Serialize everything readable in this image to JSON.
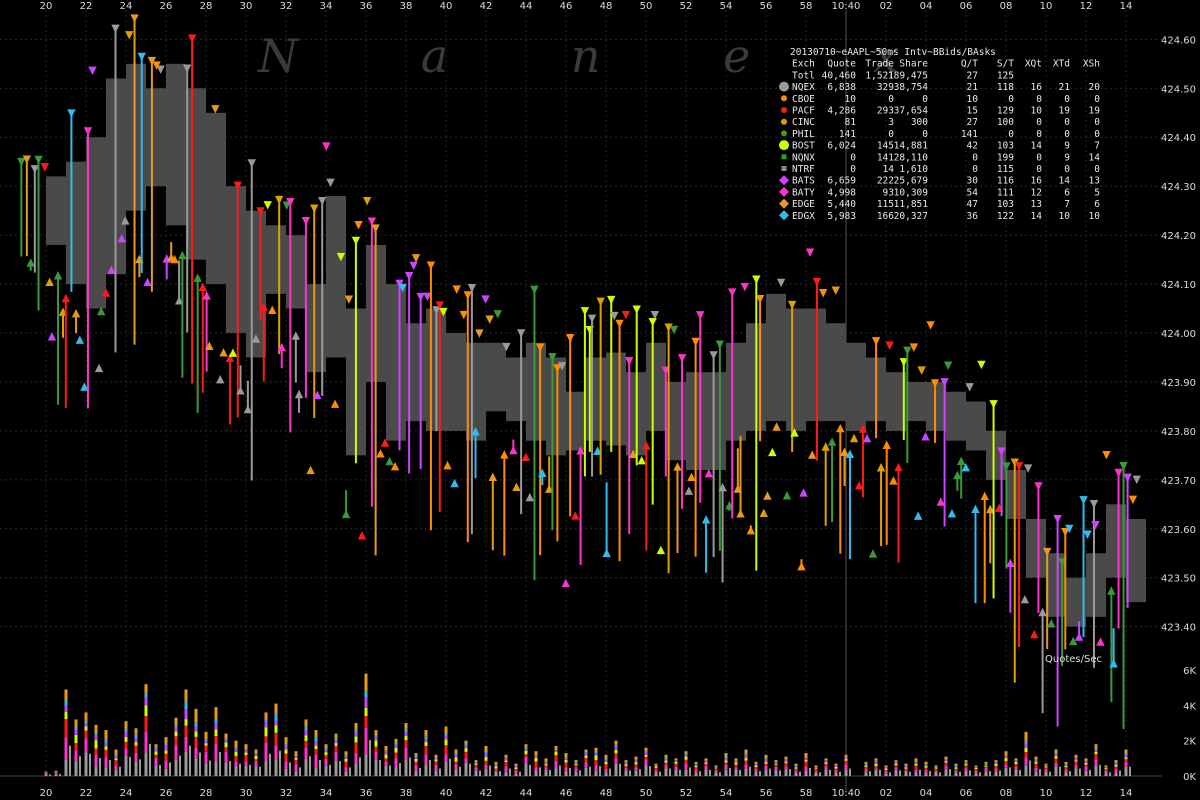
{
  "chart_data": [
    {
      "type": "scatter",
      "title": "20130710~eAAPL~50ms Intv~BBids/BAsks",
      "watermark": "N a n e x",
      "ylim": [
        423.34,
        424.66
      ],
      "y_ticks": [
        "424.60",
        "424.50",
        "424.40",
        "424.30",
        "424.20",
        "424.10",
        "424.00",
        "423.90",
        "423.80",
        "423.70",
        "423.60",
        "423.50",
        "423.40"
      ],
      "x_ticks_top": [
        "20",
        "22",
        "24",
        "26",
        "28",
        "30",
        "32",
        "34",
        "36",
        "38",
        "40",
        "42",
        "44",
        "46",
        "48",
        "50",
        "52",
        "54",
        "56",
        "58",
        "10:40",
        "02",
        "04",
        "06",
        "08",
        "10",
        "12",
        "14"
      ],
      "x_ticks_bottom": [
        "20",
        "22",
        "24",
        "26",
        "28",
        "30",
        "32",
        "34",
        "36",
        "38",
        "40",
        "42",
        "44",
        "46",
        "48",
        "50",
        "52",
        "54",
        "56",
        "58",
        "10:40",
        "02",
        "04",
        "06",
        "08",
        "10",
        "12",
        "14"
      ],
      "grid": true,
      "legend_placement": "top-right",
      "legend_header": [
        "Exch",
        "Quote",
        "Trade",
        "Share",
        "Q/T",
        "S/T",
        "XQt",
        "XTd",
        "XSh"
      ],
      "legend_total": [
        "Totl",
        "40,460",
        "1,521",
        "189,475",
        "27",
        "125",
        "",
        "",
        ""
      ],
      "series": [
        {
          "name": "NQEX",
          "quote": "6,838",
          "trade": "329",
          "share": "38,754",
          "qt": "21",
          "st": "118",
          "xqt": "16",
          "xtd": "21",
          "xsh": "20",
          "color": "#9a9a9a",
          "marker": "circle-large"
        },
        {
          "name": "CBOE",
          "quote": "10",
          "trade": "0",
          "share": "0",
          "qt": "10",
          "st": "0",
          "xqt": "0",
          "xtd": "0",
          "xsh": "0",
          "color": "#ff8c00",
          "marker": "circle"
        },
        {
          "name": "PACF",
          "quote": "4,286",
          "trade": "293",
          "share": "37,654",
          "qt": "15",
          "st": "129",
          "xqt": "10",
          "xtd": "19",
          "xsh": "19",
          "color": "#ff1a1a",
          "marker": "circle"
        },
        {
          "name": "CINC",
          "quote": "81",
          "trade": "3",
          "share": "300",
          "qt": "27",
          "st": "100",
          "xqt": "0",
          "xtd": "0",
          "xsh": "0",
          "color": "#e0a000",
          "marker": "circle"
        },
        {
          "name": "PHIL",
          "quote": "141",
          "trade": "0",
          "share": "0",
          "qt": "141",
          "st": "0",
          "xqt": "0",
          "xtd": "0",
          "xsh": "0",
          "color": "#3a9a3a",
          "marker": "circle"
        },
        {
          "name": "BOST",
          "quote": "6,024",
          "trade": "145",
          "share": "14,881",
          "qt": "42",
          "st": "103",
          "xqt": "14",
          "xtd": "9",
          "xsh": "7",
          "color": "#ccff00",
          "marker": "circle-large"
        },
        {
          "name": "NQNX",
          "quote": "0",
          "trade": "141",
          "share": "28,110",
          "qt": "0",
          "st": "199",
          "xqt": "0",
          "xtd": "9",
          "xsh": "14",
          "color": "#22aa22",
          "marker": "square"
        },
        {
          "name": "NTRF",
          "quote": "0",
          "trade": "14",
          "share": "1,610",
          "qt": "0",
          "st": "115",
          "xqt": "0",
          "xtd": "0",
          "xsh": "0",
          "color": "#8a8a8a",
          "marker": "square"
        },
        {
          "name": "BATS",
          "quote": "6,659",
          "trade": "222",
          "share": "25,679",
          "qt": "30",
          "st": "116",
          "xqt": "16",
          "xtd": "14",
          "xsh": "13",
          "color": "#cc44ff",
          "marker": "diamond"
        },
        {
          "name": "BATY",
          "quote": "4,998",
          "trade": "93",
          "share": "10,309",
          "qt": "54",
          "st": "111",
          "xqt": "12",
          "xtd": "6",
          "xsh": "5",
          "color": "#ff33cc",
          "marker": "diamond"
        },
        {
          "name": "EDGE",
          "quote": "5,440",
          "trade": "115",
          "share": "11,851",
          "qt": "47",
          "st": "103",
          "xqt": "13",
          "xtd": "7",
          "xsh": "6",
          "color": "#e69a20",
          "marker": "diamond"
        },
        {
          "name": "EDGX",
          "quote": "5,983",
          "trade": "166",
          "share": "20,327",
          "qt": "36",
          "st": "122",
          "xqt": "14",
          "xtd": "10",
          "xsh": "10",
          "color": "#33bbee",
          "marker": "diamond"
        }
      ],
      "nbbo_path": [
        {
          "x": "20",
          "bid": 424.18,
          "ask": 424.32
        },
        {
          "x": "21",
          "bid": 424.1,
          "ask": 424.35
        },
        {
          "x": "22",
          "bid": 424.05,
          "ask": 424.4
        },
        {
          "x": "23",
          "bid": 424.12,
          "ask": 424.52
        },
        {
          "x": "24",
          "bid": 424.25,
          "ask": 424.55
        },
        {
          "x": "25",
          "bid": 424.3,
          "ask": 424.5
        },
        {
          "x": "26",
          "bid": 424.22,
          "ask": 424.55
        },
        {
          "x": "27",
          "bid": 424.15,
          "ask": 424.5
        },
        {
          "x": "28",
          "bid": 424.1,
          "ask": 424.45
        },
        {
          "x": "29",
          "bid": 424.0,
          "ask": 424.3
        },
        {
          "x": "30",
          "bid": 423.95,
          "ask": 424.25
        },
        {
          "x": "31",
          "bid": 424.08,
          "ask": 424.22
        },
        {
          "x": "32",
          "bid": 424.05,
          "ask": 424.2
        },
        {
          "x": "33",
          "bid": 423.92,
          "ask": 424.1
        },
        {
          "x": "34",
          "bid": 423.95,
          "ask": 424.28
        },
        {
          "x": "35",
          "bid": 423.75,
          "ask": 424.05
        },
        {
          "x": "36",
          "bid": 423.9,
          "ask": 424.18
        },
        {
          "x": "37",
          "bid": 423.78,
          "ask": 424.1
        },
        {
          "x": "38",
          "bid": 423.82,
          "ask": 424.02
        },
        {
          "x": "39",
          "bid": 423.8,
          "ask": 424.05
        },
        {
          "x": "40",
          "bid": 423.8,
          "ask": 424.0
        },
        {
          "x": "41",
          "bid": 423.78,
          "ask": 423.98
        },
        {
          "x": "42",
          "bid": 423.84,
          "ask": 423.98
        },
        {
          "x": "43",
          "bid": 423.82,
          "ask": 423.95
        },
        {
          "x": "44",
          "bid": 423.78,
          "ask": 423.98
        },
        {
          "x": "45",
          "bid": 423.75,
          "ask": 423.95
        },
        {
          "x": "46",
          "bid": 423.76,
          "ask": 423.88
        },
        {
          "x": "47",
          "bid": 423.78,
          "ask": 423.95
        },
        {
          "x": "48",
          "bid": 423.77,
          "ask": 423.96
        },
        {
          "x": "49",
          "bid": 423.75,
          "ask": 423.92
        },
        {
          "x": "50",
          "bid": 423.8,
          "ask": 423.98
        },
        {
          "x": "51",
          "bid": 423.74,
          "ask": 423.9
        },
        {
          "x": "52",
          "bid": 423.72,
          "ask": 423.92
        },
        {
          "x": "53",
          "bid": 423.72,
          "ask": 423.92
        },
        {
          "x": "54",
          "bid": 423.78,
          "ask": 423.98
        },
        {
          "x": "55",
          "bid": 423.8,
          "ask": 424.02
        },
        {
          "x": "56",
          "bid": 423.82,
          "ask": 424.08
        },
        {
          "x": "57",
          "bid": 423.8,
          "ask": 424.05
        },
        {
          "x": "58",
          "bid": 423.82,
          "ask": 424.05
        },
        {
          "x": "59",
          "bid": 423.82,
          "ask": 424.02
        },
        {
          "x": "10:40",
          "bid": 423.8,
          "ask": 423.98
        },
        {
          "x": "01",
          "bid": 423.82,
          "ask": 423.95
        },
        {
          "x": "02",
          "bid": 423.8,
          "ask": 423.92
        },
        {
          "x": "03",
          "bid": 423.82,
          "ask": 423.9
        },
        {
          "x": "04",
          "bid": 423.8,
          "ask": 423.9
        },
        {
          "x": "05",
          "bid": 423.78,
          "ask": 423.88
        },
        {
          "x": "06",
          "bid": 423.76,
          "ask": 423.86
        },
        {
          "x": "07",
          "bid": 423.7,
          "ask": 423.8
        },
        {
          "x": "08",
          "bid": 423.62,
          "ask": 423.72
        },
        {
          "x": "09",
          "bid": 423.5,
          "ask": 423.62
        },
        {
          "x": "10",
          "bid": 423.42,
          "ask": 423.55
        },
        {
          "x": "11",
          "bid": 423.4,
          "ask": 423.5
        },
        {
          "x": "12",
          "bid": 423.42,
          "ask": 423.55
        },
        {
          "x": "13",
          "bid": 423.5,
          "ask": 423.65
        },
        {
          "x": "14",
          "bid": 423.45,
          "ask": 423.62
        }
      ]
    },
    {
      "type": "area",
      "title": "Quotes/Sec",
      "ylim": [
        0,
        6000
      ],
      "y_ticks": [
        "6K",
        "4K",
        "2K",
        "0K"
      ],
      "bursts": [
        {
          "x": "20",
          "value": 250
        },
        {
          "x": "20.5",
          "value": 300
        },
        {
          "x": "21",
          "value": 4900
        },
        {
          "x": "21.5",
          "value": 3200
        },
        {
          "x": "22",
          "value": 3600
        },
        {
          "x": "22.5",
          "value": 2900
        },
        {
          "x": "23",
          "value": 2600
        },
        {
          "x": "23.5",
          "value": 1500
        },
        {
          "x": "24",
          "value": 3100
        },
        {
          "x": "24.5",
          "value": 2700
        },
        {
          "x": "25",
          "value": 5200
        },
        {
          "x": "25.5",
          "value": 1800
        },
        {
          "x": "26",
          "value": 2200
        },
        {
          "x": "26.5",
          "value": 3300
        },
        {
          "x": "27",
          "value": 4900
        },
        {
          "x": "27.5",
          "value": 3800
        },
        {
          "x": "28",
          "value": 2500
        },
        {
          "x": "28.5",
          "value": 3900
        },
        {
          "x": "29",
          "value": 2400
        },
        {
          "x": "29.5",
          "value": 2000
        },
        {
          "x": "30",
          "value": 1800
        },
        {
          "x": "30.5",
          "value": 1500
        },
        {
          "x": "31",
          "value": 3600
        },
        {
          "x": "31.5",
          "value": 4100
        },
        {
          "x": "32",
          "value": 2200
        },
        {
          "x": "32.5",
          "value": 1400
        },
        {
          "x": "33",
          "value": 3200
        },
        {
          "x": "33.5",
          "value": 2600
        },
        {
          "x": "34",
          "value": 1800
        },
        {
          "x": "34.5",
          "value": 2400
        },
        {
          "x": "35",
          "value": 1400
        },
        {
          "x": "35.5",
          "value": 3000
        },
        {
          "x": "36",
          "value": 5800
        },
        {
          "x": "36.5",
          "value": 2600
        },
        {
          "x": "37",
          "value": 1700
        },
        {
          "x": "37.5",
          "value": 2100
        },
        {
          "x": "38",
          "value": 3000
        },
        {
          "x": "38.5",
          "value": 1300
        },
        {
          "x": "39",
          "value": 2600
        },
        {
          "x": "39.5",
          "value": 1200
        },
        {
          "x": "40",
          "value": 2800
        },
        {
          "x": "40.5",
          "value": 1500
        },
        {
          "x": "41",
          "value": 2000
        },
        {
          "x": "41.5",
          "value": 900
        },
        {
          "x": "42",
          "value": 1700
        },
        {
          "x": "42.5",
          "value": 800
        },
        {
          "x": "43",
          "value": 1200
        },
        {
          "x": "43.5",
          "value": 700
        },
        {
          "x": "44",
          "value": 1800
        },
        {
          "x": "44.5",
          "value": 1400
        },
        {
          "x": "45",
          "value": 1000
        },
        {
          "x": "45.5",
          "value": 1700
        },
        {
          "x": "46",
          "value": 1300
        },
        {
          "x": "46.5",
          "value": 900
        },
        {
          "x": "47",
          "value": 1500
        },
        {
          "x": "47.5",
          "value": 1600
        },
        {
          "x": "48",
          "value": 1200
        },
        {
          "x": "48.5",
          "value": 2000
        },
        {
          "x": "49",
          "value": 900
        },
        {
          "x": "49.5",
          "value": 1100
        },
        {
          "x": "50",
          "value": 1600
        },
        {
          "x": "50.5",
          "value": 700
        },
        {
          "x": "51",
          "value": 1200
        },
        {
          "x": "51.5",
          "value": 1000
        },
        {
          "x": "52",
          "value": 1400
        },
        {
          "x": "52.5",
          "value": 800
        },
        {
          "x": "53",
          "value": 1000
        },
        {
          "x": "53.5",
          "value": 600
        },
        {
          "x": "54",
          "value": 1300
        },
        {
          "x": "54.5",
          "value": 1000
        },
        {
          "x": "55",
          "value": 1500
        },
        {
          "x": "55.5",
          "value": 800
        },
        {
          "x": "56",
          "value": 1200
        },
        {
          "x": "56.5",
          "value": 900
        },
        {
          "x": "57",
          "value": 1100
        },
        {
          "x": "57.5",
          "value": 700
        },
        {
          "x": "58",
          "value": 1300
        },
        {
          "x": "58.5",
          "value": 600
        },
        {
          "x": "59",
          "value": 1000
        },
        {
          "x": "59.5",
          "value": 700
        },
        {
          "x": "10:40",
          "value": 1200
        },
        {
          "x": "01",
          "value": 800
        },
        {
          "x": "01.5",
          "value": 1000
        },
        {
          "x": "02",
          "value": 600
        },
        {
          "x": "02.5",
          "value": 900
        },
        {
          "x": "03",
          "value": 700
        },
        {
          "x": "03.5",
          "value": 1000
        },
        {
          "x": "04",
          "value": 800
        },
        {
          "x": "04.5",
          "value": 600
        },
        {
          "x": "05",
          "value": 1100
        },
        {
          "x": "05.5",
          "value": 700
        },
        {
          "x": "06",
          "value": 900
        },
        {
          "x": "06.5",
          "value": 600
        },
        {
          "x": "07",
          "value": 800
        },
        {
          "x": "07.5",
          "value": 900
        },
        {
          "x": "08",
          "value": 1400
        },
        {
          "x": "08.5",
          "value": 1000
        },
        {
          "x": "09",
          "value": 2500
        },
        {
          "x": "09.5",
          "value": 1100
        },
        {
          "x": "10",
          "value": 700
        },
        {
          "x": "10.5",
          "value": 1500
        },
        {
          "x": "11",
          "value": 800
        },
        {
          "x": "11.5",
          "value": 1200
        },
        {
          "x": "12",
          "value": 1000
        },
        {
          "x": "12.5",
          "value": 1800
        },
        {
          "x": "13",
          "value": 600
        },
        {
          "x": "13.5",
          "value": 900
        },
        {
          "x": "14",
          "value": 1500
        }
      ]
    }
  ]
}
